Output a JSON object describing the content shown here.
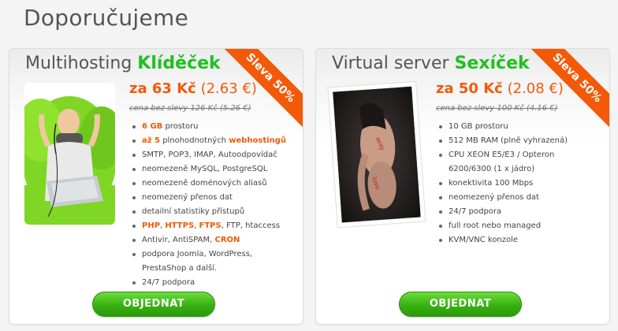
{
  "page_title": "Doporučujeme",
  "colors": {
    "accent_green": "#20c020",
    "accent_orange": "#f25a0a",
    "button_green": "#39b012"
  },
  "cards": [
    {
      "title_prefix": "Multihosting",
      "title_accent": "Klíděček",
      "ribbon": "Sleva 50%",
      "price_main": "za 63 Kč",
      "price_eur": "(2.63 €)",
      "old_price": "cena bez slevy 126 Kč (5.26 €)",
      "features": [
        {
          "hl": "6 GB",
          "text": " prostoru"
        },
        {
          "hl": "až 5",
          "text": " plnohodnotných ",
          "hl2": "webhostingů"
        },
        {
          "text": "SMTP, POP3, IMAP, Autoodpovídač"
        },
        {
          "text": "neomezeně MySQL, PostgreSQL"
        },
        {
          "text": "neomezeně doménových aliasů"
        },
        {
          "text": "neomezený přenos dat"
        },
        {
          "text": "detailní statistiky přístupů"
        },
        {
          "hl": "PHP",
          "text": ", ",
          "hl2": "HTTPS",
          "text2": ", ",
          "hl3": "FTPS",
          "text3": ", FTP, htaccess"
        },
        {
          "text": "Antivir, AntiSPAM, ",
          "hl2": "CRON"
        },
        {
          "text": "podpora Joomla, WordPress,",
          "cont": "PrestaShop a další."
        },
        {
          "text": "24/7 podpora"
        }
      ],
      "button": "OBJEDNAT"
    },
    {
      "title_prefix": "Virtual server",
      "title_accent": "Sexíček",
      "ribbon": "Sleva 50%",
      "price_main": "za 50 Kč",
      "price_eur": "(2.08 €)",
      "old_price": "cena bez slevy 100 Kč (4.16 €)",
      "features": [
        {
          "text": "10 GB prostoru"
        },
        {
          "text": "512 MB RAM (plně vyhrazená)"
        },
        {
          "text": "CPU XEON E5/E3 / Opteron",
          "cont": "6200/6300 (1 x jádro)"
        },
        {
          "text": "konektivita 100 Mbps"
        },
        {
          "text": "neomezený přenos dat"
        },
        {
          "text": "24/7 podpora"
        },
        {
          "text": "full root nebo managed"
        },
        {
          "text": "KVM/VNC konzole"
        }
      ],
      "button": "OBJEDNAT"
    }
  ]
}
